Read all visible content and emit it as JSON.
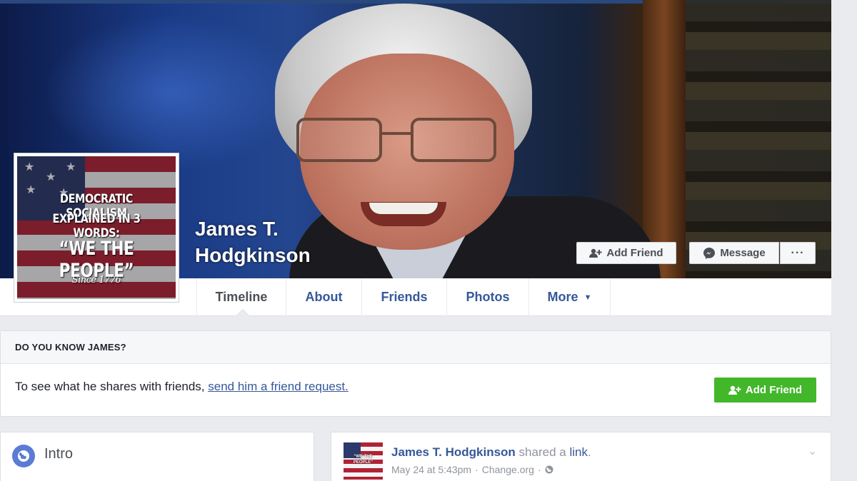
{
  "profile": {
    "name_line1": "James T.",
    "name_line2": "Hodgkinson",
    "picture_lines": [
      "DEMOCRATIC SOCIALISM",
      "EXPLAINED IN 3 WORDS:",
      "“WE THE PEOPLE”",
      "Since 1776"
    ]
  },
  "cover_actions": {
    "add_friend": "Add Friend",
    "message": "Message",
    "more": "···"
  },
  "nav": {
    "tabs": [
      "Timeline",
      "About",
      "Friends",
      "Photos",
      "More"
    ],
    "active": "Timeline"
  },
  "know_card": {
    "heading": "DO YOU KNOW JAMES?",
    "text": "To see what he shares with friends, ",
    "link": "send him a friend request.",
    "button": "Add Friend"
  },
  "intro": {
    "title": "Intro"
  },
  "post": {
    "author": "James T. Hodgkinson",
    "action": " shared a ",
    "link_word": "link",
    "period": ".",
    "time": "May 24 at 5:43pm",
    "source": "Change.org",
    "audience_icon": "globe-icon"
  },
  "colors": {
    "fb_blue": "#365899",
    "add_green": "#42b72a",
    "page_bg": "#e9ebee"
  }
}
